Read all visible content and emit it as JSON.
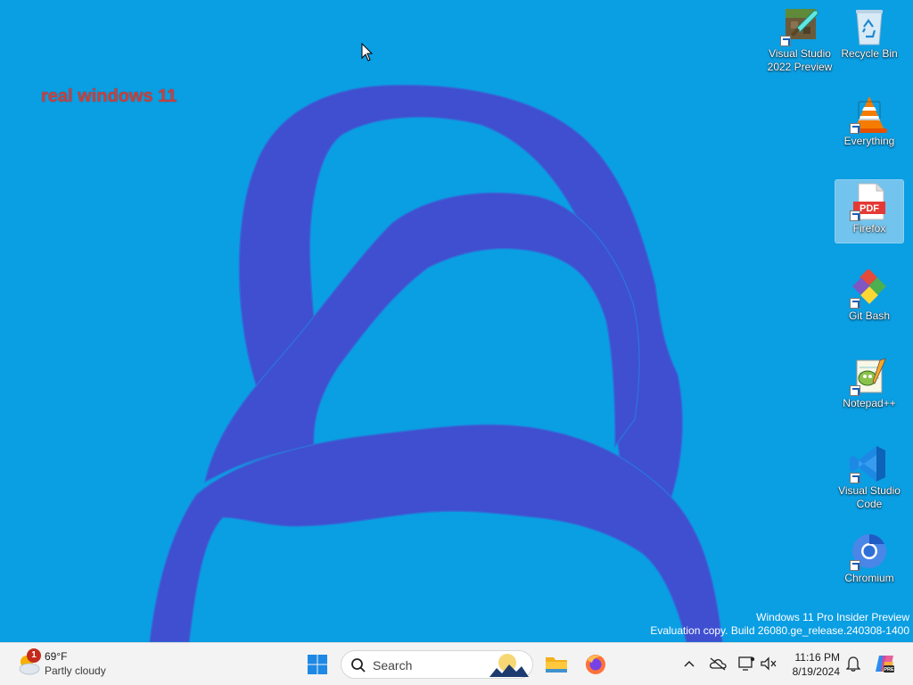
{
  "desktop": {
    "wallpaper_caption": "real windows 11",
    "icons": [
      {
        "label": "Visual Studio 2022 Preview",
        "icon": "minecraft-sword-icon"
      },
      {
        "label": "Recycle Bin",
        "icon": "recycle-bin-icon"
      },
      {
        "label": "Everything",
        "icon": "vlc-cone-icon"
      },
      {
        "label": "Firefox",
        "icon": "pdf-file-icon",
        "selected": true
      },
      {
        "label": "Git Bash",
        "icon": "git-bash-icon"
      },
      {
        "label": "Notepad++",
        "icon": "notepad-plus-plus-icon"
      },
      {
        "label": "Visual Studio Code",
        "icon": "vscode-icon"
      },
      {
        "label": "Chromium",
        "icon": "chromium-icon"
      }
    ],
    "watermark": {
      "line1": "Windows 11 Pro Insider Preview",
      "line2": "Evaluation copy. Build 26080.ge_release.240308-1400"
    }
  },
  "taskbar": {
    "weather": {
      "temperature": "69°F",
      "condition": "Partly cloudy",
      "badge_count": "1"
    },
    "search_placeholder": "Search",
    "pinned": [
      "start-button",
      "file-explorer",
      "firefox"
    ],
    "clock": {
      "time": "11:16 PM",
      "date": "8/19/2024"
    }
  },
  "colors": {
    "desktop_bg": "#0a9ee3",
    "painted_stroke": "#3f4fd0",
    "caption": "#c8413e",
    "taskbar_bg": "#f3f3f3",
    "accent": "#0067c0"
  }
}
